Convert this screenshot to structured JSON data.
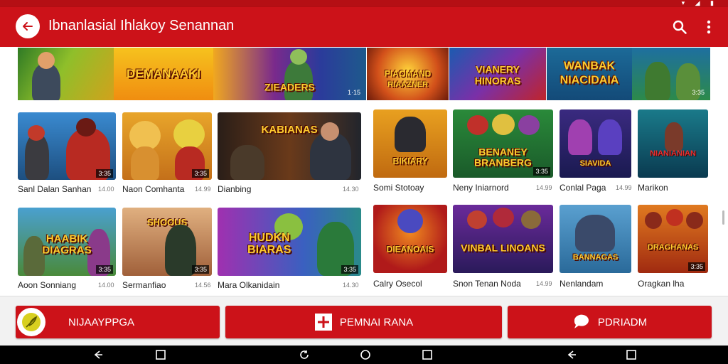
{
  "status_bar": {
    "icons": "▾ ◢ ▮"
  },
  "app_bar": {
    "title": "Ibnanlasial Ihlakoy Senannan",
    "back_icon": "back-arrow-icon",
    "search_icon": "search-icon",
    "menu_icon": "more-vertical-icon"
  },
  "banners": [
    {
      "label": "DEMANAAKI",
      "sub": "",
      "tag": ""
    },
    {
      "label": "",
      "sub": "ZIEADERS",
      "tag": "1·15"
    },
    {
      "label": "PIAOMAND",
      "sub": "RIAAZNER",
      "tag": ""
    },
    {
      "label": "VIANERY",
      "sub": "HINORAS",
      "tag": ""
    },
    {
      "label": "WANBAK",
      "sub": "NIACIDAIA",
      "tag": ""
    },
    {
      "label": "",
      "sub": "",
      "tag": "3:35"
    }
  ],
  "cards_row1": [
    {
      "title": "",
      "badge": "3:35",
      "name": "Sanl Dalan Sanhan",
      "price": "14.00"
    },
    {
      "title": "",
      "badge": "3:35",
      "name": "Naon Comhanta",
      "price": "14.99"
    },
    {
      "title": "KABIANAS",
      "badge": "",
      "name": "Dianbing",
      "price": "14.30"
    },
    {
      "title": "BIKIARY",
      "badge": "",
      "name": "Somi Stotoay",
      "price": ""
    },
    {
      "title": "BENANEY BRANBERG",
      "badge": "3:35",
      "name": "Neny Iniarnord",
      "price": "14.99"
    },
    {
      "title": "SIAVIDA",
      "badge": "",
      "name": "Conlal Paga",
      "price": "14.99"
    },
    {
      "title": "NIANIANIAN",
      "badge": "",
      "name": "Marikon",
      "price": ""
    }
  ],
  "cards_row2": [
    {
      "title": "HAABIK DIAGRAS",
      "badge": "3:35",
      "name": "Aoon Sonniang",
      "price": "14.00"
    },
    {
      "title": "SHOOUS",
      "badge": "3:35",
      "name": "Sermanfiao",
      "price": "14.56"
    },
    {
      "title": "HUDKN BIARAS",
      "badge": "3:35",
      "name": "Mara Olkanidain",
      "price": "14.30"
    },
    {
      "title": "DIEANOAIS",
      "badge": "",
      "name": "Calry Osecol",
      "price": ""
    },
    {
      "title": "VINBAL LINOANS",
      "badge": "",
      "name": "Snon Tenan Noda",
      "price": "14.99"
    },
    {
      "title": "BANNAGAS",
      "badge": "",
      "name": "Nenlandam",
      "price": ""
    },
    {
      "title": "DRAGHANAS",
      "badge": "3:35",
      "name": "Oragkan lha",
      "price": ""
    }
  ],
  "bottom_buttons": [
    {
      "label": "NIJAAYPPGA",
      "icon": "leaf-icon"
    },
    {
      "label": "PEMNAI RANA",
      "icon": "plus-box-icon"
    },
    {
      "label": "PDRIADM",
      "icon": "chat-bubble-icon"
    }
  ],
  "colors": {
    "primary": "#cc1219",
    "dark": "#b50f14",
    "accent": "#ffcc2e"
  }
}
